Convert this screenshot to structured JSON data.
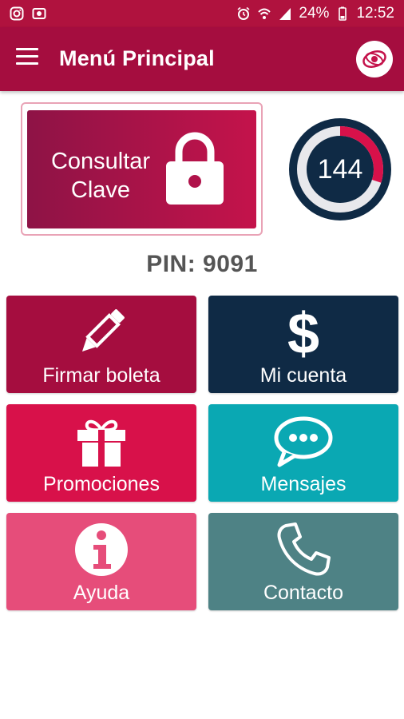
{
  "status_bar": {
    "battery": "24%",
    "time": "12:52"
  },
  "app_bar": {
    "title": "Menú Principal"
  },
  "clave_button": {
    "line1": "Consultar",
    "line2": "Clave"
  },
  "counter": {
    "value": "144",
    "fraction_filled": 0.3
  },
  "pin": {
    "text": "PIN: 9091"
  },
  "tiles": [
    {
      "label": "Firmar boleta",
      "icon": "pencil-icon",
      "color": "#a50d3f"
    },
    {
      "label": "Mi cuenta",
      "icon": "dollar-icon",
      "color": "#0f2a45"
    },
    {
      "label": "Promociones",
      "icon": "gift-icon",
      "color": "#d8114a"
    },
    {
      "label": "Mensajes",
      "icon": "chat-icon",
      "color": "#0aa8b3"
    },
    {
      "label": "Ayuda",
      "icon": "info-icon",
      "color": "#e64d7a"
    },
    {
      "label": "Contacto",
      "icon": "phone-icon",
      "color": "#4e8285"
    }
  ],
  "colors": {
    "status_bar": "#b0123e",
    "app_bar": "#a50d3f",
    "accent_ring": "#d8114a",
    "ring_background": "#0f2a45"
  }
}
